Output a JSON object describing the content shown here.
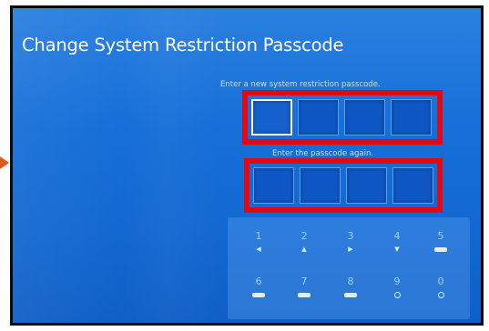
{
  "screen": {
    "title": "Change System Restriction Passcode",
    "prompt_new": "Enter a new system restriction passcode.",
    "prompt_again": "Enter the passcode again."
  },
  "keypad": {
    "row1": [
      {
        "digit": "1",
        "icon": "dpad-left-icon",
        "glyph": "◀"
      },
      {
        "digit": "2",
        "icon": "dpad-up-icon",
        "glyph": "▲"
      },
      {
        "digit": "3",
        "icon": "dpad-right-icon",
        "glyph": "▶"
      },
      {
        "digit": "4",
        "icon": "dpad-down-icon",
        "glyph": "▼"
      },
      {
        "digit": "5",
        "icon": "r1-button-icon",
        "glyph": ""
      }
    ],
    "row2": [
      {
        "digit": "6",
        "icon": "l1-button-icon",
        "glyph": ""
      },
      {
        "digit": "7",
        "icon": "l2-button-icon",
        "glyph": ""
      },
      {
        "digit": "8",
        "icon": "r2-button-icon",
        "glyph": ""
      },
      {
        "digit": "9",
        "icon": "triangle-button-icon",
        "glyph": ""
      },
      {
        "digit": "0",
        "icon": "square-button-icon",
        "glyph": ""
      }
    ]
  },
  "colors": {
    "highlight": "#e10a14",
    "background": "#1a6fd8"
  }
}
